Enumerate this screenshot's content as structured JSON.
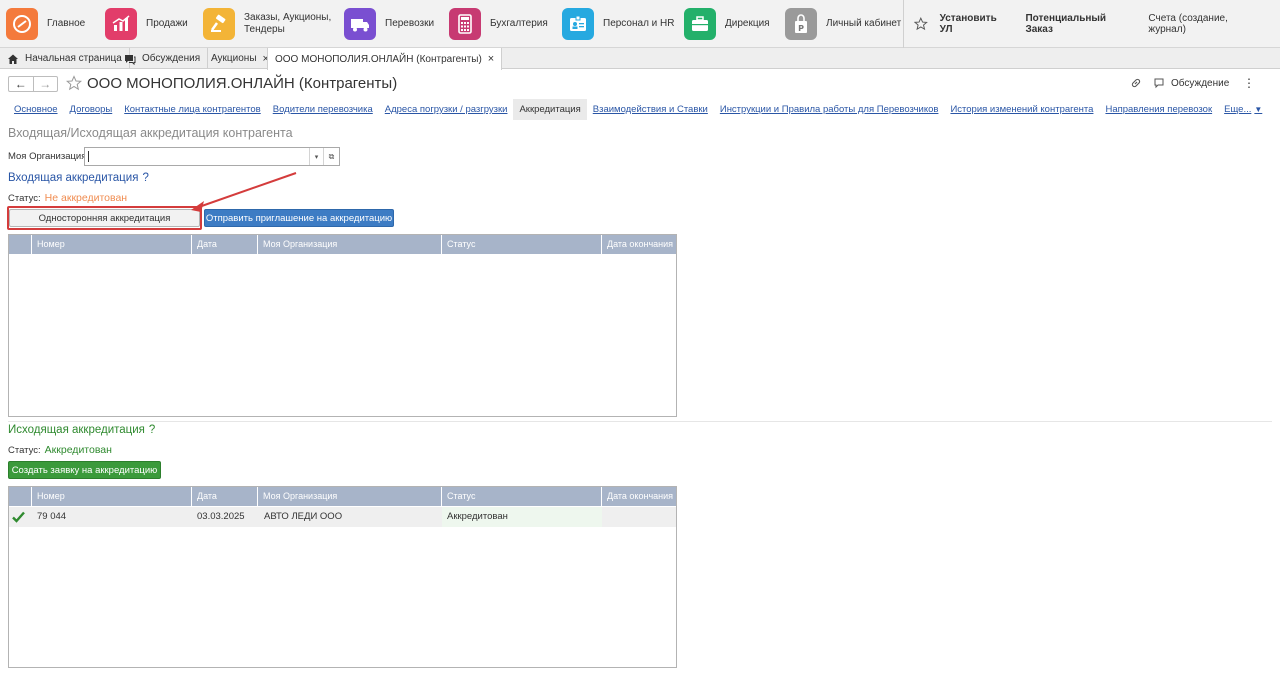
{
  "sections": [
    {
      "label": "Главное",
      "icon": "main-section-icon",
      "color": "#f47a3c"
    },
    {
      "label": "Продажи",
      "icon": "sales-chart-icon",
      "color": "#e23d6a"
    },
    {
      "label": "Заказы, Аукционы, Тендеры",
      "icon": "gavel-icon",
      "color": "#f3b437"
    },
    {
      "label": "Перевозки",
      "icon": "truck-icon",
      "color": "#7a4fd1"
    },
    {
      "label": "Бухгалтерия",
      "icon": "calculator-icon",
      "color": "#c73a72"
    },
    {
      "label": "Персонал и HR",
      "icon": "badge-icon",
      "color": "#26a9e0"
    },
    {
      "label": "Дирекция",
      "icon": "briefcase-icon",
      "color": "#23b06a"
    },
    {
      "label": "Личный кабинет",
      "icon": "parking-icon",
      "color": "#9a9a9a"
    }
  ],
  "top_links": {
    "install": "Установить УЛ",
    "potential": "Потенциальный Заказ",
    "invoices": "Счета (создание, журнал)"
  },
  "tabs": [
    {
      "label": "Начальная страница",
      "icon": "home-icon"
    },
    {
      "label": "Обсуждения",
      "icon": "chat-icon"
    },
    {
      "label": "Аукционы",
      "close": "×"
    },
    {
      "label": "ООО МОНОПОЛИЯ.ОНЛАЙН (Контрагенты)",
      "close": "×"
    }
  ],
  "form": {
    "back": "←",
    "forward": "→",
    "title": "ООО МОНОПОЛИЯ.ОНЛАЙН (Контрагенты)",
    "discussion": "Обсуждение",
    "more": "⋮"
  },
  "subnav": [
    "Основное",
    "Договоры",
    "Контактные лица контрагентов",
    "Водители перевозчика",
    "Адреса погрузки / разгрузки",
    "Аккредитация",
    "Взаимодействия и Ставки",
    "Инструкции и Правила работы для Перевозчиков",
    "История изменений контрагента",
    "Направления перевозок",
    "Еще..."
  ],
  "page_heading": "Входящая/Исходящая аккредитация контрагента",
  "org": {
    "label": "Моя Организация:",
    "value": "",
    "dropdown_glyph": "▾",
    "open_glyph": "⧉"
  },
  "incoming": {
    "heading": "Входящая аккредитация",
    "help": "?",
    "status_label": "Статус:",
    "status_value": "Не аккредитован",
    "btn_unilateral": "Односторонняя аккредитация",
    "btn_invite": "Отправить приглашение на аккредитацию",
    "columns": [
      "Номер",
      "Дата",
      "Моя Организация",
      "Статус",
      "Дата окончания"
    ]
  },
  "outgoing": {
    "heading": "Исходящая аккредитация",
    "help": "?",
    "status_label": "Статус:",
    "status_value": "Аккредитован",
    "btn_create": "Создать заявку на аккредитацию",
    "columns": [
      "Номер",
      "Дата",
      "Моя Организация",
      "Статус",
      "Дата окончания"
    ],
    "rows": [
      {
        "number": "79 044",
        "date": "03.03.2025",
        "org": "АВТО ЛЕДИ ООО",
        "status": "Аккредитован",
        "end_date": ""
      }
    ]
  },
  "colors": {
    "link": "#2a56a6",
    "accent_green": "#2f8a2f",
    "warning_orange": "#f08c50",
    "annotation_red": "#d43c3c",
    "table_header": "#a7b4c9"
  }
}
